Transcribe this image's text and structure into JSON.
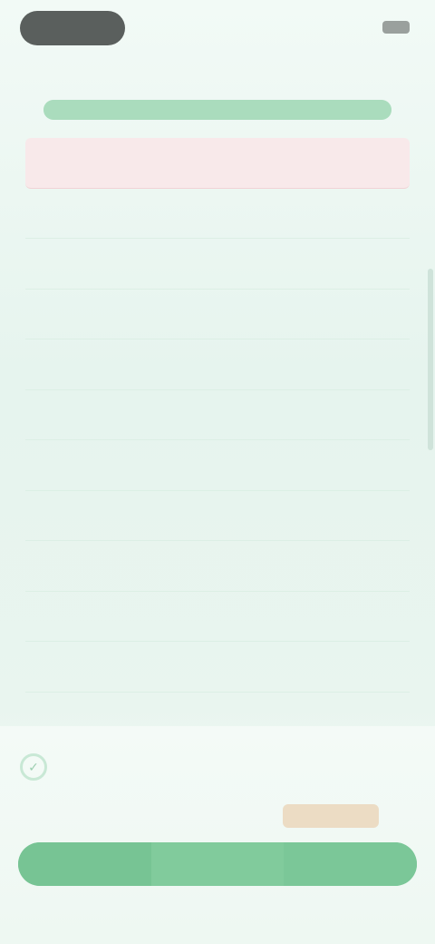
{
  "status_bar": {
    "left_label": "",
    "right_label": ""
  },
  "header": {
    "title": "",
    "progress_percent": 100
  },
  "rows": [
    {
      "key": "",
      "value": "",
      "highlight": true
    },
    {
      "key": "",
      "value": ""
    },
    {
      "key": "",
      "value": ""
    },
    {
      "key": "",
      "value": ""
    },
    {
      "key": "",
      "value": ""
    },
    {
      "key": "",
      "value": ""
    },
    {
      "key": "",
      "value": ""
    },
    {
      "key": "",
      "value": ""
    },
    {
      "key": "",
      "value": ""
    },
    {
      "key": "",
      "value": ""
    },
    {
      "key": "",
      "value": ""
    }
  ],
  "section": {
    "icon": "check-circle-icon",
    "title": "",
    "link_left": "",
    "link_right": ""
  },
  "bottom_bar": {
    "left_label": "",
    "middle_label": "",
    "right_label": ""
  },
  "colors": {
    "accent": "#7ec99a",
    "highlight_row": "#f8e9ea",
    "background": "#e9f5ef"
  }
}
